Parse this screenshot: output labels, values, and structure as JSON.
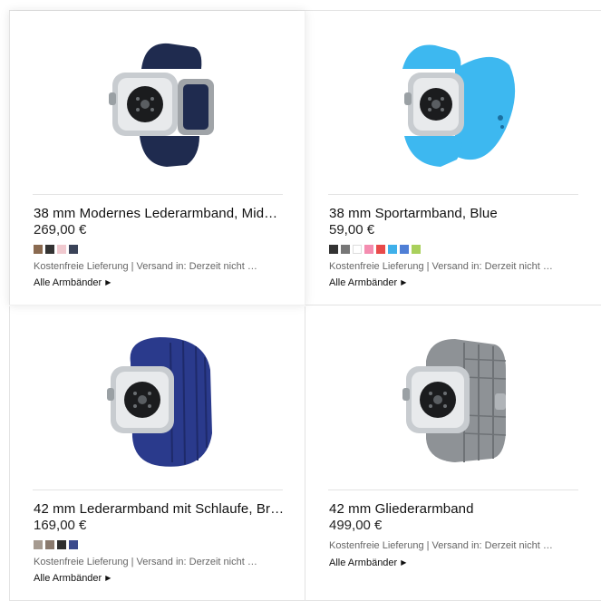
{
  "products": [
    {
      "title": "38 mm Modernes Lederarmband, Mid…",
      "price": "269,00 €",
      "swatches": [
        "#8a6a50",
        "#333333",
        "#f0c9cf",
        "#3a4358"
      ],
      "delivery": "Kostenfreie Lieferung | Versand in: Derzeit nicht …",
      "link": "Alle Armbänder",
      "band_color": "#1f2b4f",
      "icon": "modern-leather-band-watch-image"
    },
    {
      "title": "38 mm Sportarmband, Blue",
      "price": "59,00 €",
      "swatches": [
        "#333333",
        "#777777",
        "#ffffff",
        "#f48db0",
        "#e84a4a",
        "#3fb0ea",
        "#4f7fd6",
        "#a9d05c"
      ],
      "delivery": "Kostenfreie Lieferung | Versand in: Derzeit nicht …",
      "link": "Alle Armbänder",
      "band_color": "#3db8f0",
      "icon": "sport-band-watch-image"
    },
    {
      "title": "42 mm Lederarmband mit Schlaufe, Br…",
      "price": "169,00 €",
      "swatches": [
        "#a59a90",
        "#8a7a6e",
        "#2f2f2f",
        "#3a4a8c"
      ],
      "delivery": "Kostenfreie Lieferung | Versand in: Derzeit nicht …",
      "link": "Alle Armbänder",
      "band_color": "#2a3a8c",
      "icon": "leather-loop-watch-image"
    },
    {
      "title": "42 mm Gliederarmband",
      "price": "499,00 €",
      "swatches": [],
      "delivery": "Kostenfreie Lieferung | Versand in: Derzeit nicht …",
      "link": "Alle Armbänder",
      "band_color": "#8e9296",
      "icon": "link-bracelet-watch-image"
    }
  ]
}
